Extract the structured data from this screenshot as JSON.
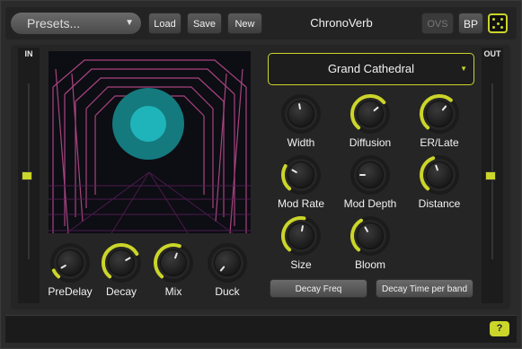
{
  "header": {
    "preset_label": "Presets...",
    "load_label": "Load",
    "save_label": "Save",
    "new_label": "New",
    "title": "ChronoVerb",
    "ovs_label": "OVS",
    "bp_label": "BP"
  },
  "meters": {
    "in_label": "IN",
    "out_label": "OUT"
  },
  "preset_name": "Grand Cathedral",
  "knobs": {
    "predelay": "PreDelay",
    "decay": "Decay",
    "mix": "Mix",
    "duck": "Duck",
    "width": "Width",
    "diffusion": "Diffusion",
    "er_late": "ER/Late",
    "mod_rate": "Mod Rate",
    "mod_depth": "Mod Depth",
    "distance": "Distance",
    "size": "Size",
    "bloom": "Bloom"
  },
  "buttons": {
    "decay_freq": "Decay Freq",
    "decay_time_per_band": "Decay Time per band"
  },
  "help_label": "?",
  "colors": {
    "accent": "#cbd52a",
    "viz_circle": "#1fb4ba",
    "viz_lines": "#b84a8a"
  }
}
